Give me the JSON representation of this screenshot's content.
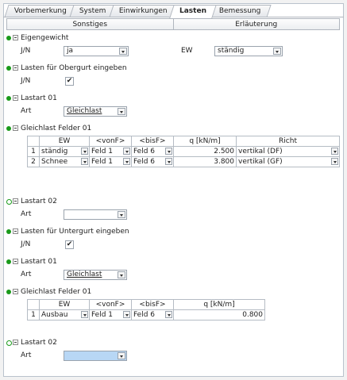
{
  "tabs": [
    "Vorbemerkung",
    "System",
    "Einwirkungen",
    "Lasten",
    "Bemessung"
  ],
  "subtabs": [
    "Sonstiges",
    "Erläuterung"
  ],
  "eigengewicht": {
    "title": "Eigengewicht",
    "jn_label": "J/N",
    "jn_value": "ja",
    "ew_label": "EW",
    "ew_value": "ständig"
  },
  "obergurt": {
    "title": "Lasten für Obergurt eingeben",
    "jn_label": "J/N",
    "checked": "✔",
    "lastart1": {
      "title": "Lastart 01",
      "art_label": "Art",
      "art_value": "Gleichlast"
    },
    "felder": {
      "title": "Gleichlast Felder 01",
      "headers": [
        "",
        "EW",
        "<vonF>",
        "<bisF>",
        "q [kN/m]",
        "Richt"
      ],
      "rows": [
        {
          "nr": "1",
          "ew": "ständig",
          "von": "Feld 1",
          "bis": "Feld 6",
          "q": "2.500",
          "richt": "vertikal (DF)"
        },
        {
          "nr": "2",
          "ew": "Schnee",
          "von": "Feld 1",
          "bis": "Feld 6",
          "q": "3.800",
          "richt": "vertikal (GF)"
        }
      ]
    },
    "lastart2": {
      "title": "Lastart 02",
      "art_label": "Art",
      "art_value": ""
    }
  },
  "untergurt": {
    "title": "Lasten für Untergurt eingeben",
    "jn_label": "J/N",
    "checked": "✔",
    "lastart1": {
      "title": "Lastart 01",
      "art_label": "Art",
      "art_value": "Gleichlast"
    },
    "felder": {
      "title": "Gleichlast Felder 01",
      "headers": [
        "",
        "EW",
        "<vonF>",
        "<bisF>",
        "q [kN/m]"
      ],
      "rows": [
        {
          "nr": "1",
          "ew": "Ausbau",
          "von": "Feld 1",
          "bis": "Feld 6",
          "q": "0.800"
        }
      ]
    },
    "lastart2": {
      "title": "Lastart 02",
      "art_label": "Art",
      "art_value": ""
    }
  },
  "colors": {
    "status_dot": "#1a9a1a",
    "selection": "#b8d7f5"
  }
}
